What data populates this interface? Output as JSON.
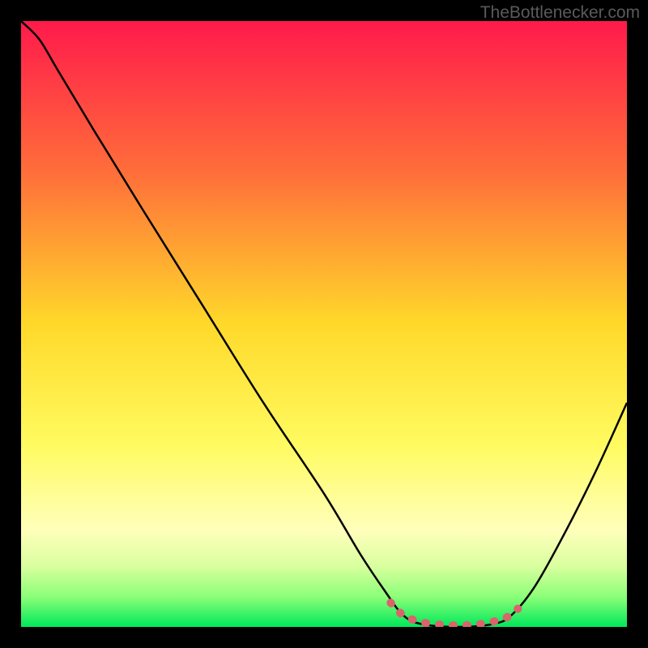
{
  "watermark": "TheBottlenecker.com",
  "chart_data": {
    "type": "line",
    "title": "",
    "xlabel": "",
    "ylabel": "",
    "xlim": [
      0,
      100
    ],
    "ylim": [
      0,
      100
    ],
    "background_gradient": {
      "stops": [
        {
          "offset": 0,
          "color": "#ff1a4b"
        },
        {
          "offset": 25,
          "color": "#ff6e3a"
        },
        {
          "offset": 50,
          "color": "#ffd92a"
        },
        {
          "offset": 70,
          "color": "#fffb60"
        },
        {
          "offset": 84,
          "color": "#ffffbb"
        },
        {
          "offset": 90,
          "color": "#d9ff9f"
        },
        {
          "offset": 95,
          "color": "#8cff78"
        },
        {
          "offset": 100,
          "color": "#00e85a"
        }
      ]
    },
    "series": [
      {
        "name": "main-curve",
        "color": "#000000",
        "points": [
          {
            "x": 0,
            "y": 100
          },
          {
            "x": 3,
            "y": 97
          },
          {
            "x": 6,
            "y": 92
          },
          {
            "x": 12,
            "y": 82
          },
          {
            "x": 20,
            "y": 69
          },
          {
            "x": 30,
            "y": 53
          },
          {
            "x": 40,
            "y": 37
          },
          {
            "x": 50,
            "y": 22
          },
          {
            "x": 56,
            "y": 12
          },
          {
            "x": 60,
            "y": 6
          },
          {
            "x": 63,
            "y": 2
          },
          {
            "x": 66,
            "y": 0.5
          },
          {
            "x": 72,
            "y": 0
          },
          {
            "x": 78,
            "y": 0.5
          },
          {
            "x": 81,
            "y": 2
          },
          {
            "x": 85,
            "y": 7
          },
          {
            "x": 90,
            "y": 16
          },
          {
            "x": 95,
            "y": 26
          },
          {
            "x": 100,
            "y": 37
          }
        ]
      },
      {
        "name": "highlight-band",
        "color": "#d9646b",
        "points": [
          {
            "x": 61,
            "y": 4
          },
          {
            "x": 63,
            "y": 2
          },
          {
            "x": 66,
            "y": 0.8
          },
          {
            "x": 70,
            "y": 0.3
          },
          {
            "x": 74,
            "y": 0.3
          },
          {
            "x": 77,
            "y": 0.7
          },
          {
            "x": 80,
            "y": 1.5
          },
          {
            "x": 82,
            "y": 3
          }
        ]
      }
    ]
  }
}
